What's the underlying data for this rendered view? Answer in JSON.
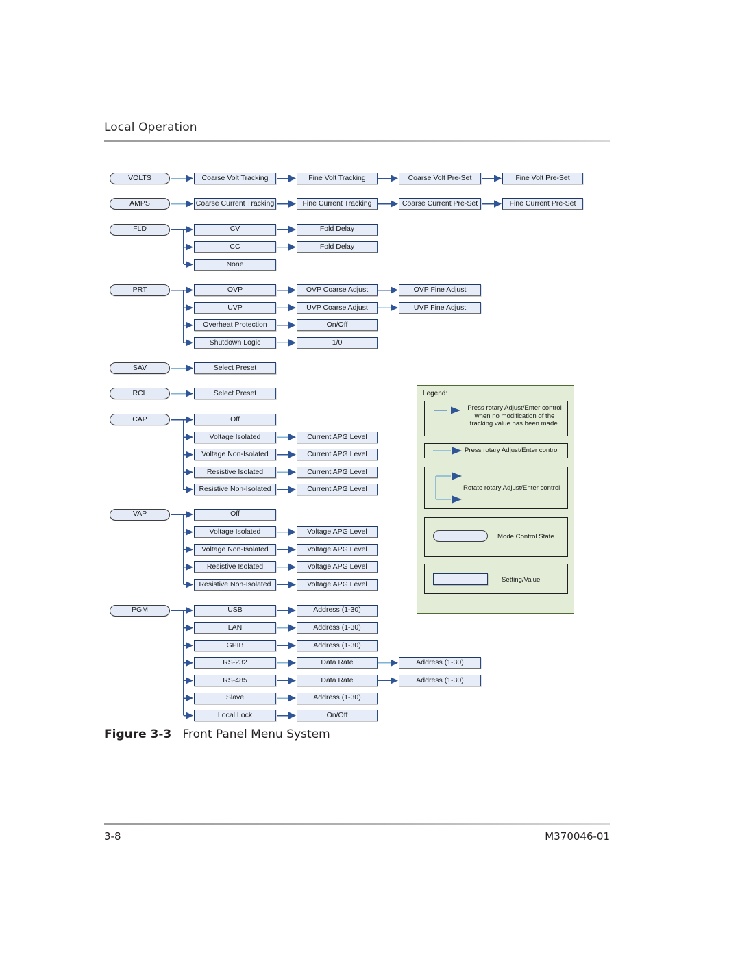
{
  "page": {
    "header_title": "Local Operation",
    "figure_number": "Figure 3-3",
    "figure_title": "Front Panel Menu System",
    "page_number": "3-8",
    "document_id": "M370046-01"
  },
  "colors": {
    "box_fill": "#e6edf8",
    "box_border": "#1f3864",
    "pill_fill": "#e4ebf7",
    "pill_border": "#3f3f3f",
    "arrow_dark": "#2f5597",
    "arrow_light": "#7fb3d5",
    "legend_fill": "#e3ecd6",
    "legend_border": "#4f6b33"
  },
  "diagram": {
    "rows": [
      {
        "id": "volts",
        "mode": "VOLTS",
        "branches": [
          {
            "chain": [
              "Coarse Volt Tracking",
              "Fine Volt Tracking",
              "Coarse Volt Pre-Set",
              "Fine Volt Pre-Set"
            ]
          }
        ]
      },
      {
        "id": "amps",
        "mode": "AMPS",
        "branches": [
          {
            "chain": [
              "Coarse Current Tracking",
              "Fine Current Tracking",
              "Coarse Current Pre-Set",
              "Fine Current Pre-Set"
            ]
          }
        ]
      },
      {
        "id": "fld",
        "mode": "FLD",
        "branches": [
          {
            "chain": [
              "CV",
              "Fold Delay"
            ]
          },
          {
            "chain": [
              "CC",
              "Fold Delay"
            ]
          },
          {
            "chain": [
              "None"
            ]
          }
        ]
      },
      {
        "id": "prt",
        "mode": "PRT",
        "branches": [
          {
            "chain": [
              "OVP",
              "OVP Coarse Adjust",
              "OVP Fine Adjust"
            ]
          },
          {
            "chain": [
              "UVP",
              "UVP Coarse Adjust",
              "UVP Fine Adjust"
            ]
          },
          {
            "chain": [
              "Overheat Protection",
              "On/Off"
            ]
          },
          {
            "chain": [
              "Shutdown Logic",
              "1/0"
            ]
          }
        ]
      },
      {
        "id": "sav",
        "mode": "SAV",
        "branches": [
          {
            "chain": [
              "Select Preset"
            ]
          }
        ]
      },
      {
        "id": "rcl",
        "mode": "RCL",
        "branches": [
          {
            "chain": [
              "Select Preset"
            ]
          }
        ]
      },
      {
        "id": "cap",
        "mode": "CAP",
        "branches": [
          {
            "chain": [
              "Off"
            ]
          },
          {
            "chain": [
              "Voltage Isolated",
              "Current APG Level"
            ]
          },
          {
            "chain": [
              "Voltage Non-Isolated",
              "Current APG Level"
            ]
          },
          {
            "chain": [
              "Resistive Isolated",
              "Current APG Level"
            ]
          },
          {
            "chain": [
              "Resistive Non-Isolated",
              "Current APG Level"
            ]
          }
        ]
      },
      {
        "id": "vap",
        "mode": "VAP",
        "branches": [
          {
            "chain": [
              "Off"
            ]
          },
          {
            "chain": [
              "Voltage Isolated",
              "Voltage APG Level"
            ]
          },
          {
            "chain": [
              "Voltage Non-Isolated",
              "Voltage APG Level"
            ]
          },
          {
            "chain": [
              "Resistive Isolated",
              "Voltage APG Level"
            ]
          },
          {
            "chain": [
              "Resistive Non-Isolated",
              "Voltage APG Level"
            ]
          }
        ]
      },
      {
        "id": "pgm",
        "mode": "PGM",
        "branches": [
          {
            "chain": [
              "USB",
              "Address (1-30)"
            ]
          },
          {
            "chain": [
              "LAN",
              "Address (1-30)"
            ]
          },
          {
            "chain": [
              "GPIB",
              "Address (1-30)"
            ]
          },
          {
            "chain": [
              "RS-232",
              "Data Rate",
              "Address (1-30)"
            ]
          },
          {
            "chain": [
              "RS-485",
              "Data Rate",
              "Address (1-30)"
            ]
          },
          {
            "chain": [
              "Slave",
              "Address (1-30)"
            ]
          },
          {
            "chain": [
              "Local Lock",
              "On/Off"
            ]
          }
        ]
      }
    ]
  },
  "legend": {
    "title": "Legend:",
    "entries": [
      {
        "id": "press-no-mod",
        "symbol": "short-line-arrow",
        "lines": [
          "Press rotary Adjust/Enter control",
          "when no modification of the",
          "tracking value has been made."
        ]
      },
      {
        "id": "press",
        "symbol": "long-line-arrow",
        "lines": [
          "Press rotary Adjust/Enter control"
        ]
      },
      {
        "id": "rotate",
        "symbol": "branch-arrows",
        "lines": [
          "Rotate rotary Adjust/Enter control"
        ]
      },
      {
        "id": "mode-control-state",
        "symbol": "pill-shape",
        "lines": [
          "Mode Control State"
        ]
      },
      {
        "id": "setting-value",
        "symbol": "rect-shape",
        "lines": [
          "Setting/Value"
        ]
      }
    ]
  }
}
